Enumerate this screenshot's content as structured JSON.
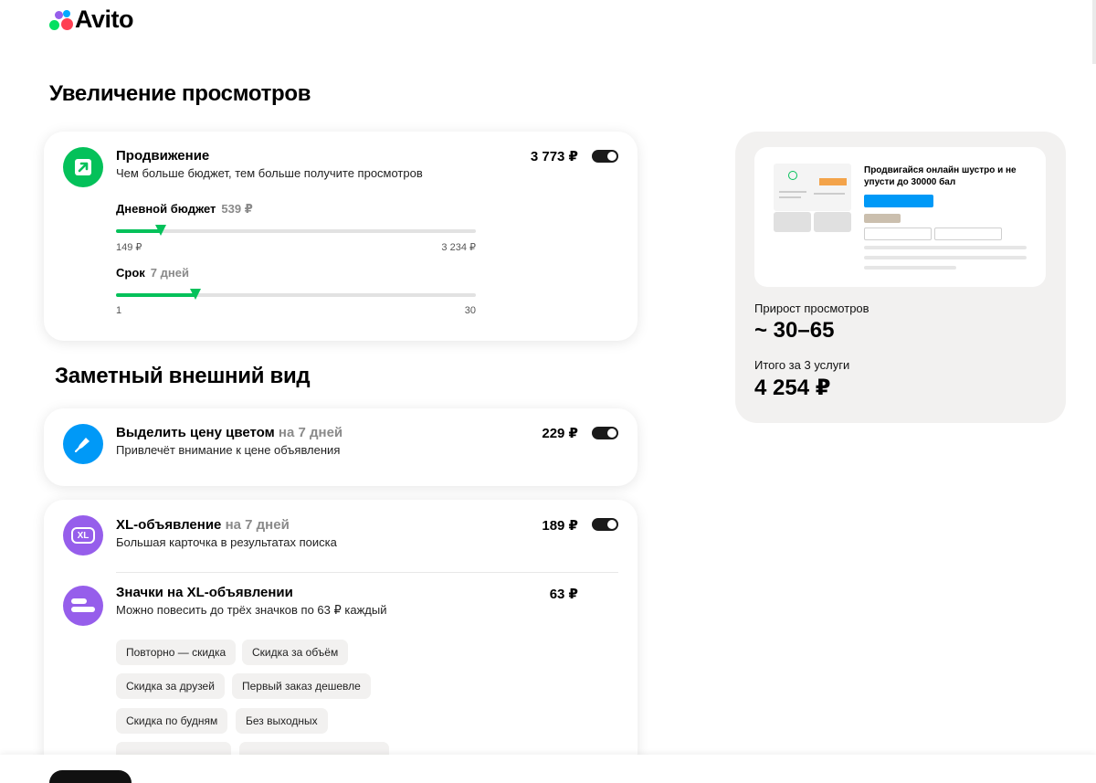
{
  "brand": {
    "logo_text": "Avito"
  },
  "sections": {
    "views_title": "Увеличение просмотров",
    "appearance_title": "Заметный внешний вид"
  },
  "promotion": {
    "icon": "arrow-up-right-icon",
    "title": "Продвижение",
    "subtitle": "Чем больше бюджет, тем больше получите просмотров",
    "price": "3 773 ₽",
    "enabled": true,
    "budget": {
      "label": "Дневной бюджет",
      "value": "539 ₽",
      "min": "149 ₽",
      "max": "3 234 ₽",
      "fraction": 0.125
    },
    "duration": {
      "label": "Срок",
      "value": "7 дней",
      "min": "1",
      "max": "30",
      "fraction": 0.22
    }
  },
  "highlight": {
    "icon": "marker-icon",
    "title": "Выделить цену цветом",
    "title_suffix": "на 7 дней",
    "subtitle": "Привлечёт внимание к цене объявления",
    "price": "229 ₽",
    "enabled": true
  },
  "xl": {
    "icon": "xl-icon",
    "icon_text": "XL",
    "title": "XL-объявление",
    "title_suffix": "на 7 дней",
    "subtitle": "Большая карточка в результатах поиска",
    "price": "189 ₽",
    "enabled": true
  },
  "badges": {
    "icon": "badges-icon",
    "title": "Значки на XL-объявлении",
    "subtitle": "Можно повесить до трёх значков по 63 ₽ каждый",
    "price": "63 ₽",
    "chips": [
      "Повторно — скидка",
      "Скидка за объём",
      "Скидка за друзей",
      "Первый заказ дешевле",
      "Скидка по будням",
      "Без выходных"
    ]
  },
  "summary": {
    "preview_text": "Продвигайся онлайн шустро и не упусти до 30000 бал",
    "views_label": "Прирост просмотров",
    "views_value": "~ 30–65",
    "total_label": "Итого за 3 услуги",
    "total_value": "4 254 ₽"
  },
  "colors": {
    "accent_green": "#04c15a",
    "blue": "#0099f7",
    "purple": "#965eeb",
    "toggle": "#1a1a1a"
  }
}
